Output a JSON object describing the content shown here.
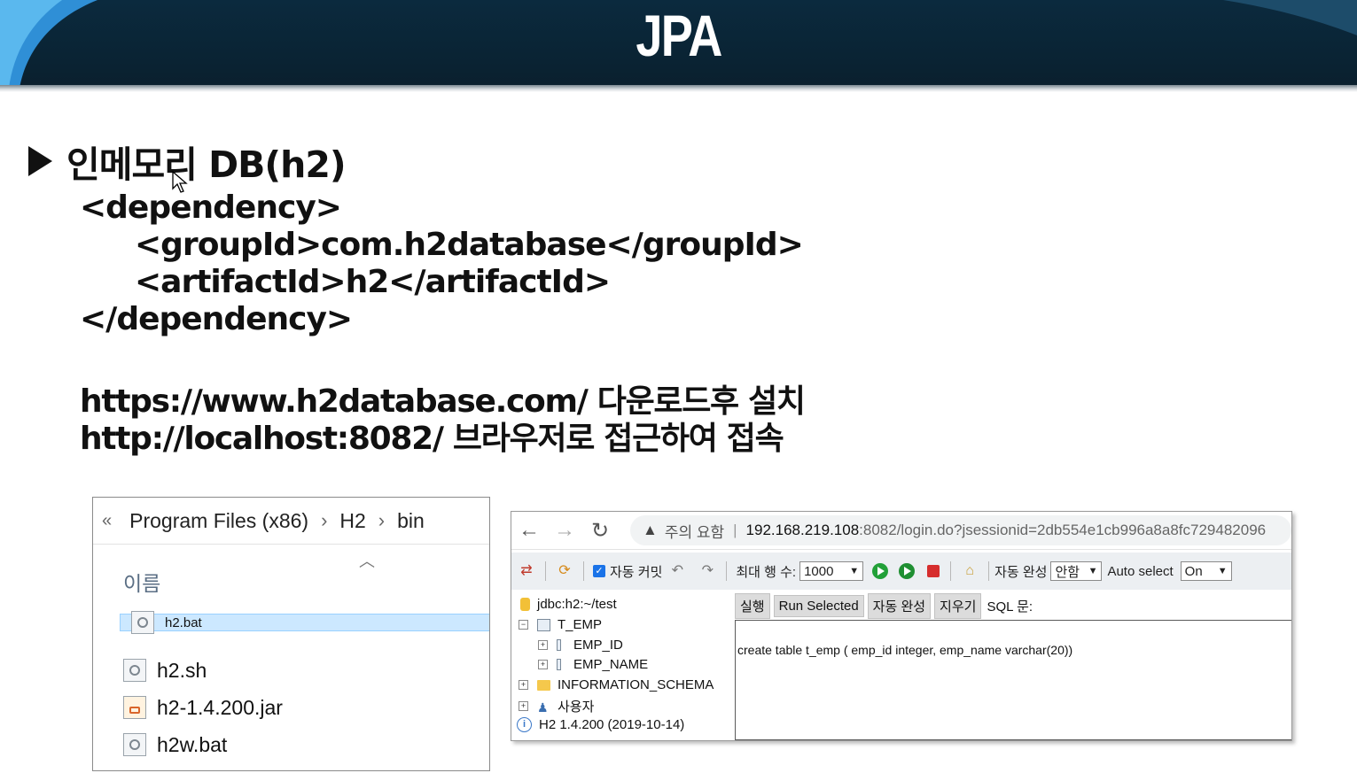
{
  "banner": {
    "title": "JPA"
  },
  "slide": {
    "heading": "인메모리 DB(h2)",
    "code": {
      "open": "<dependency>",
      "group": "<groupId>com.h2database</groupId>",
      "artifact": "<artifactId>h2</artifactId>",
      "close": "</dependency>"
    },
    "lines": {
      "download": "https://www.h2database.com/  다운로드후 설치",
      "access": "http://localhost:8082/ 브라우저로 접근하여 접속"
    }
  },
  "explorer": {
    "path": [
      "Program Files (x86)",
      "H2",
      "bin"
    ],
    "column_name": "이름",
    "files": [
      {
        "name": "h2.bat",
        "icon": "batch-file-icon",
        "selected": true
      },
      {
        "name": "h2.sh",
        "icon": "script-file-icon",
        "selected": false
      },
      {
        "name": "h2-1.4.200.jar",
        "icon": "java-jar-icon",
        "selected": false
      },
      {
        "name": "h2w.bat",
        "icon": "batch-file-icon",
        "selected": false
      }
    ]
  },
  "console": {
    "address": {
      "warning": "주의 요함",
      "host": "192.168.219.108",
      "path": ":8082/login.do?jsessionid=2db554e1cb996a8a8fc729482096"
    },
    "toolbar": {
      "auto_commit": "자동 커밋",
      "max_rows_label": "최대 행 수:",
      "max_rows_value": "1000",
      "autocomplete_label": "자동 완성",
      "autocomplete_value": "안함",
      "auto_select_label": "Auto select",
      "auto_select_value": "On"
    },
    "tree": {
      "connection": "jdbc:h2:~/test",
      "table": "T_EMP",
      "columns": [
        "EMP_ID",
        "EMP_NAME"
      ],
      "schema": "INFORMATION_SCHEMA",
      "users": "사용자",
      "version": "H2 1.4.200 (2019-10-14)"
    },
    "buttons": {
      "run": "실행",
      "run_selected": "Run Selected",
      "autocomplete": "자동 완성",
      "clear": "지우기",
      "sql_label": "SQL 문:"
    },
    "sql": "create table t_emp ( emp_id integer, emp_name  varchar(20))"
  }
}
